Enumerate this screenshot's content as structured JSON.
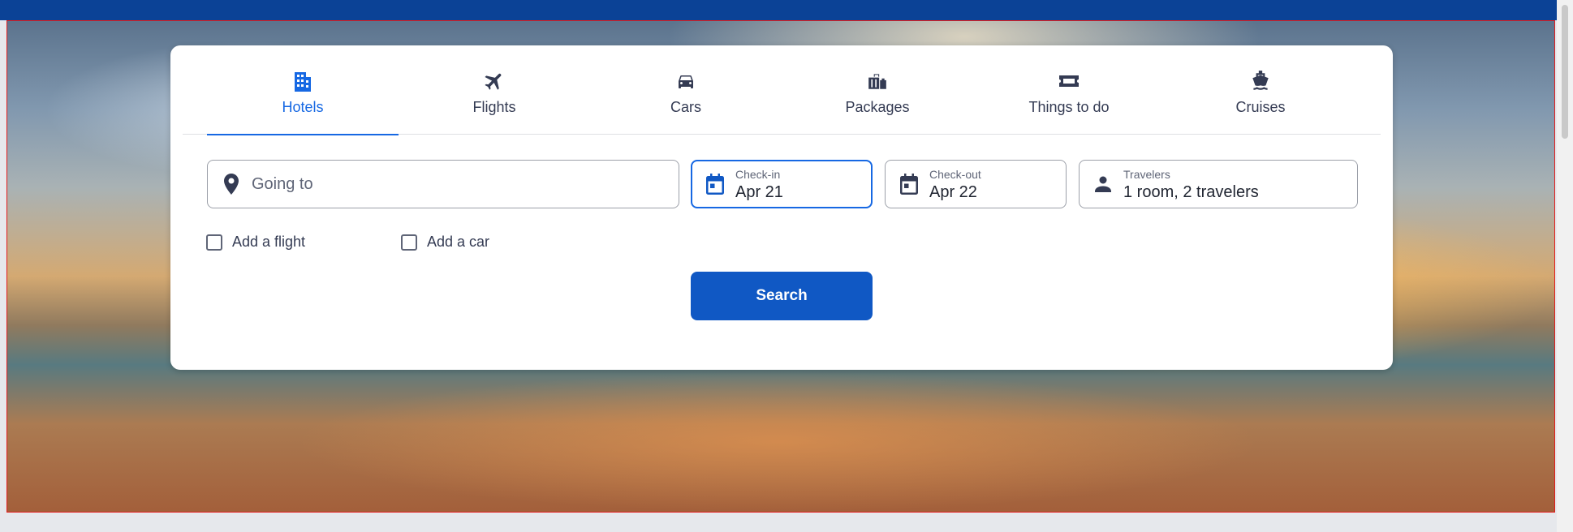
{
  "tabs": [
    {
      "label": "Hotels",
      "icon": "hotel-icon",
      "active": true
    },
    {
      "label": "Flights",
      "icon": "plane-icon",
      "active": false
    },
    {
      "label": "Cars",
      "icon": "car-icon",
      "active": false
    },
    {
      "label": "Packages",
      "icon": "luggage-icon",
      "active": false
    },
    {
      "label": "Things to do",
      "icon": "ticket-icon",
      "active": false
    },
    {
      "label": "Cruises",
      "icon": "ship-icon",
      "active": false
    }
  ],
  "destination": {
    "placeholder": "Going to",
    "icon": "map-pin-icon"
  },
  "checkin": {
    "label": "Check-in",
    "value": "Apr 21",
    "icon": "calendar-icon"
  },
  "checkout": {
    "label": "Check-out",
    "value": "Apr 22",
    "icon": "calendar-icon"
  },
  "travelers": {
    "label": "Travelers",
    "value": "1 room, 2 travelers",
    "icon": "person-icon"
  },
  "options": {
    "add_flight": "Add a flight",
    "add_car": "Add a car"
  },
  "search_button": "Search",
  "colors": {
    "brand_blue": "#0b4296",
    "accent": "#1668e3",
    "button": "#1058c4",
    "highlight_frame": "#e21b1b"
  }
}
